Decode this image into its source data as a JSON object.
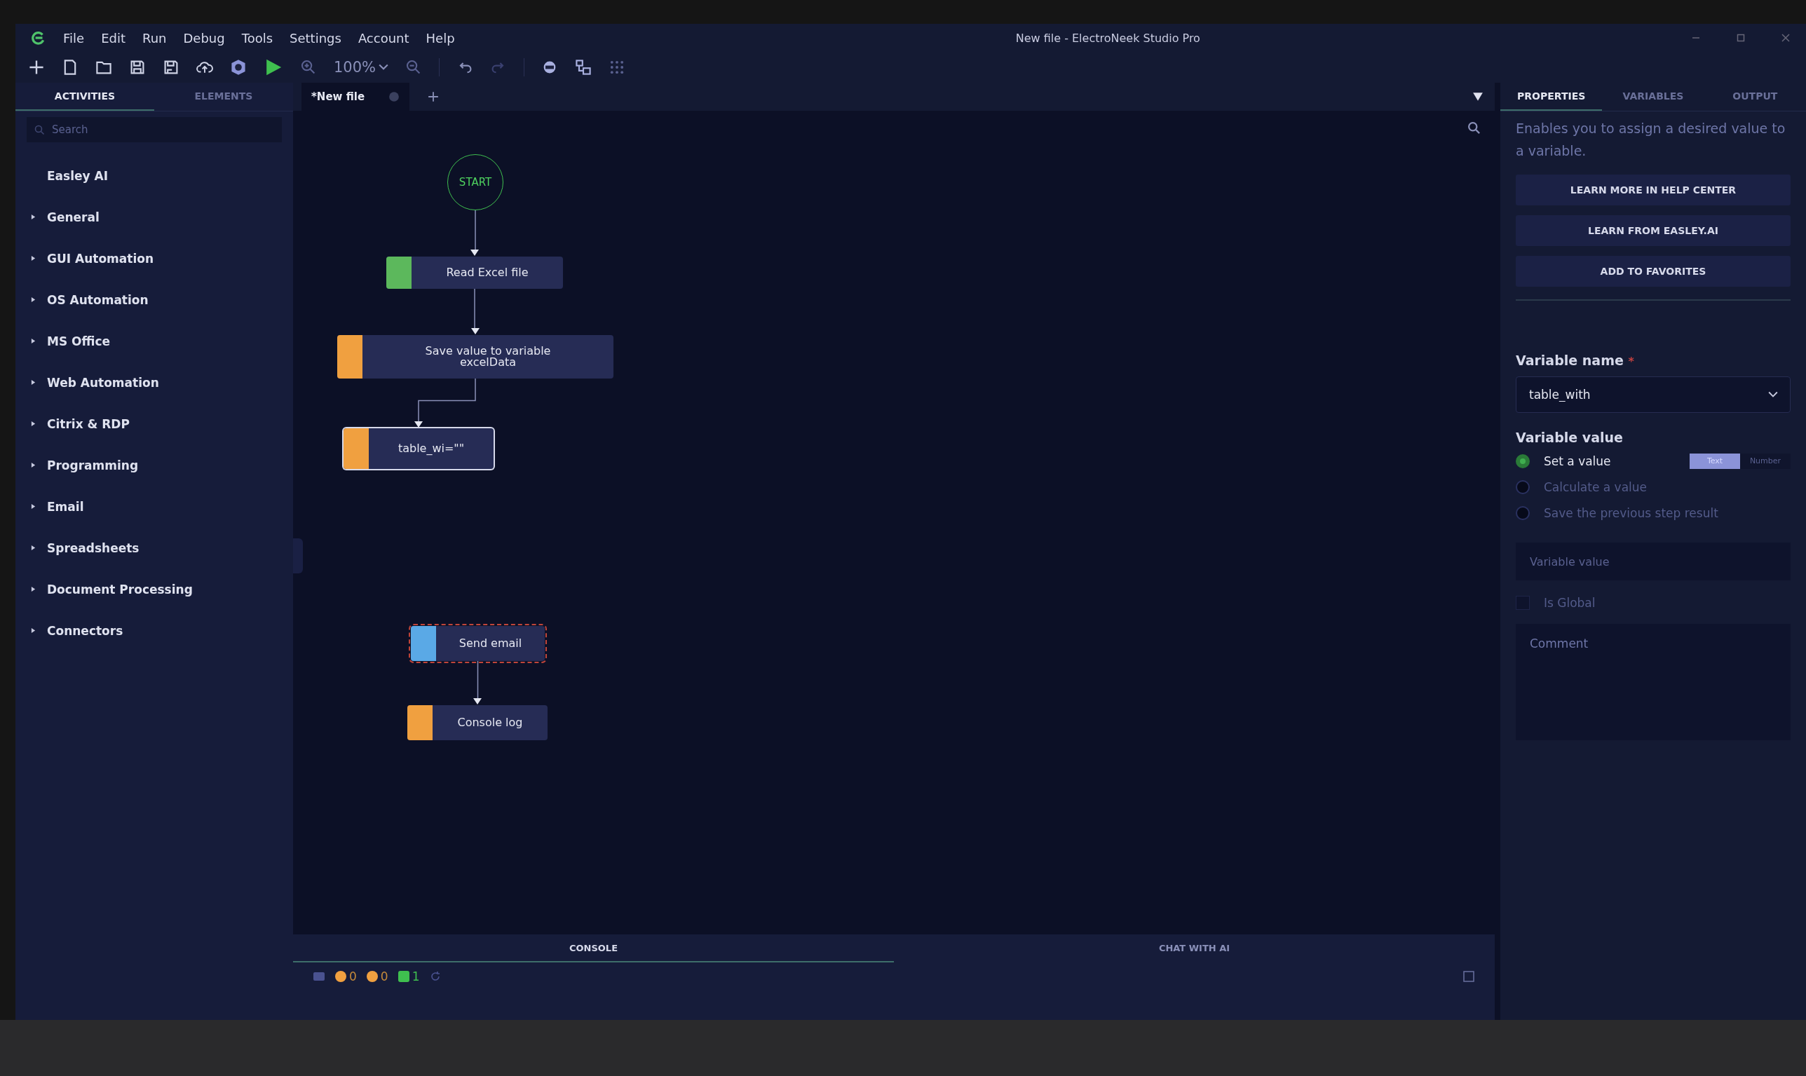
{
  "window": {
    "title": "New file - ElectroNeek Studio Pro"
  },
  "menu": [
    "File",
    "Edit",
    "Run",
    "Debug",
    "Tools",
    "Settings",
    "Account",
    "Help"
  ],
  "toolbar": {
    "zoom": "100%"
  },
  "left_tabs": [
    {
      "label": "ACTIVITIES",
      "selected": true
    },
    {
      "label": "ELEMENTS",
      "selected": false
    }
  ],
  "search": {
    "placeholder": "Search"
  },
  "activities": [
    {
      "label": "Easley AI",
      "expandable": false
    },
    {
      "label": "General",
      "expandable": true
    },
    {
      "label": "GUI Automation",
      "expandable": true
    },
    {
      "label": "OS Automation",
      "expandable": true
    },
    {
      "label": "MS Office",
      "expandable": true
    },
    {
      "label": "Web Automation",
      "expandable": true
    },
    {
      "label": "Citrix & RDP",
      "expandable": true
    },
    {
      "label": "Programming",
      "expandable": true
    },
    {
      "label": "Email",
      "expandable": true
    },
    {
      "label": "Spreadsheets",
      "expandable": true
    },
    {
      "label": "Document Processing",
      "expandable": true
    },
    {
      "label": "Connectors",
      "expandable": true
    }
  ],
  "file_tabs": [
    {
      "label": "*New file",
      "selected": true
    }
  ],
  "nodes": [
    {
      "kind": "start",
      "label": "START",
      "links_to_next": true
    },
    {
      "kind": "action",
      "label": "Read Excel file",
      "color": "#5cb85c",
      "selected": false,
      "error": false,
      "links_to_next": true
    },
    {
      "kind": "action",
      "label": "Save value to variable\nexcelData",
      "color": "#f0a040",
      "selected": false,
      "error": false,
      "links_to_next": true
    },
    {
      "kind": "action",
      "label": "table_wi=\"\"",
      "color": "#f0a040",
      "selected": true,
      "error": false,
      "links_to_next": false
    },
    {
      "kind": "action",
      "label": "Send email",
      "color": "#5aa9e6",
      "selected": false,
      "error": true,
      "links_to_next": true
    },
    {
      "kind": "action",
      "label": "Console log",
      "color": "#f0a040",
      "selected": false,
      "error": false,
      "links_to_next": false
    }
  ],
  "bottom_tabs": [
    {
      "label": "CONSOLE",
      "selected": true
    },
    {
      "label": "CHAT WITH AI",
      "selected": false
    }
  ],
  "console_counts": {
    "errors": "0",
    "warnings": "0",
    "info": "1"
  },
  "right_tabs": [
    {
      "label": "PROPERTIES",
      "selected": true
    },
    {
      "label": "VARIABLES",
      "selected": false
    },
    {
      "label": "OUTPUT",
      "selected": false
    }
  ],
  "properties": {
    "description": "Enables you to assign a desired value to a variable.",
    "buttons": [
      "LEARN MORE IN HELP CENTER",
      "LEARN FROM EASLEY.AI",
      "ADD TO FAVORITES"
    ],
    "variable_name": {
      "label": "Variable name",
      "required": "*",
      "value": "table_with"
    },
    "variable_value": {
      "label": "Variable value",
      "options": [
        {
          "label": "Set a value",
          "selected": true
        },
        {
          "label": "Calculate a value",
          "selected": false
        },
        {
          "label": "Save the previous step result",
          "selected": false
        }
      ],
      "types": [
        {
          "label": "Text",
          "selected": true
        },
        {
          "label": "Number",
          "selected": false
        }
      ],
      "placeholder": "Variable value"
    },
    "is_global": {
      "label": "Is Global",
      "checked": false
    },
    "comment": {
      "placeholder": "Comment"
    }
  }
}
